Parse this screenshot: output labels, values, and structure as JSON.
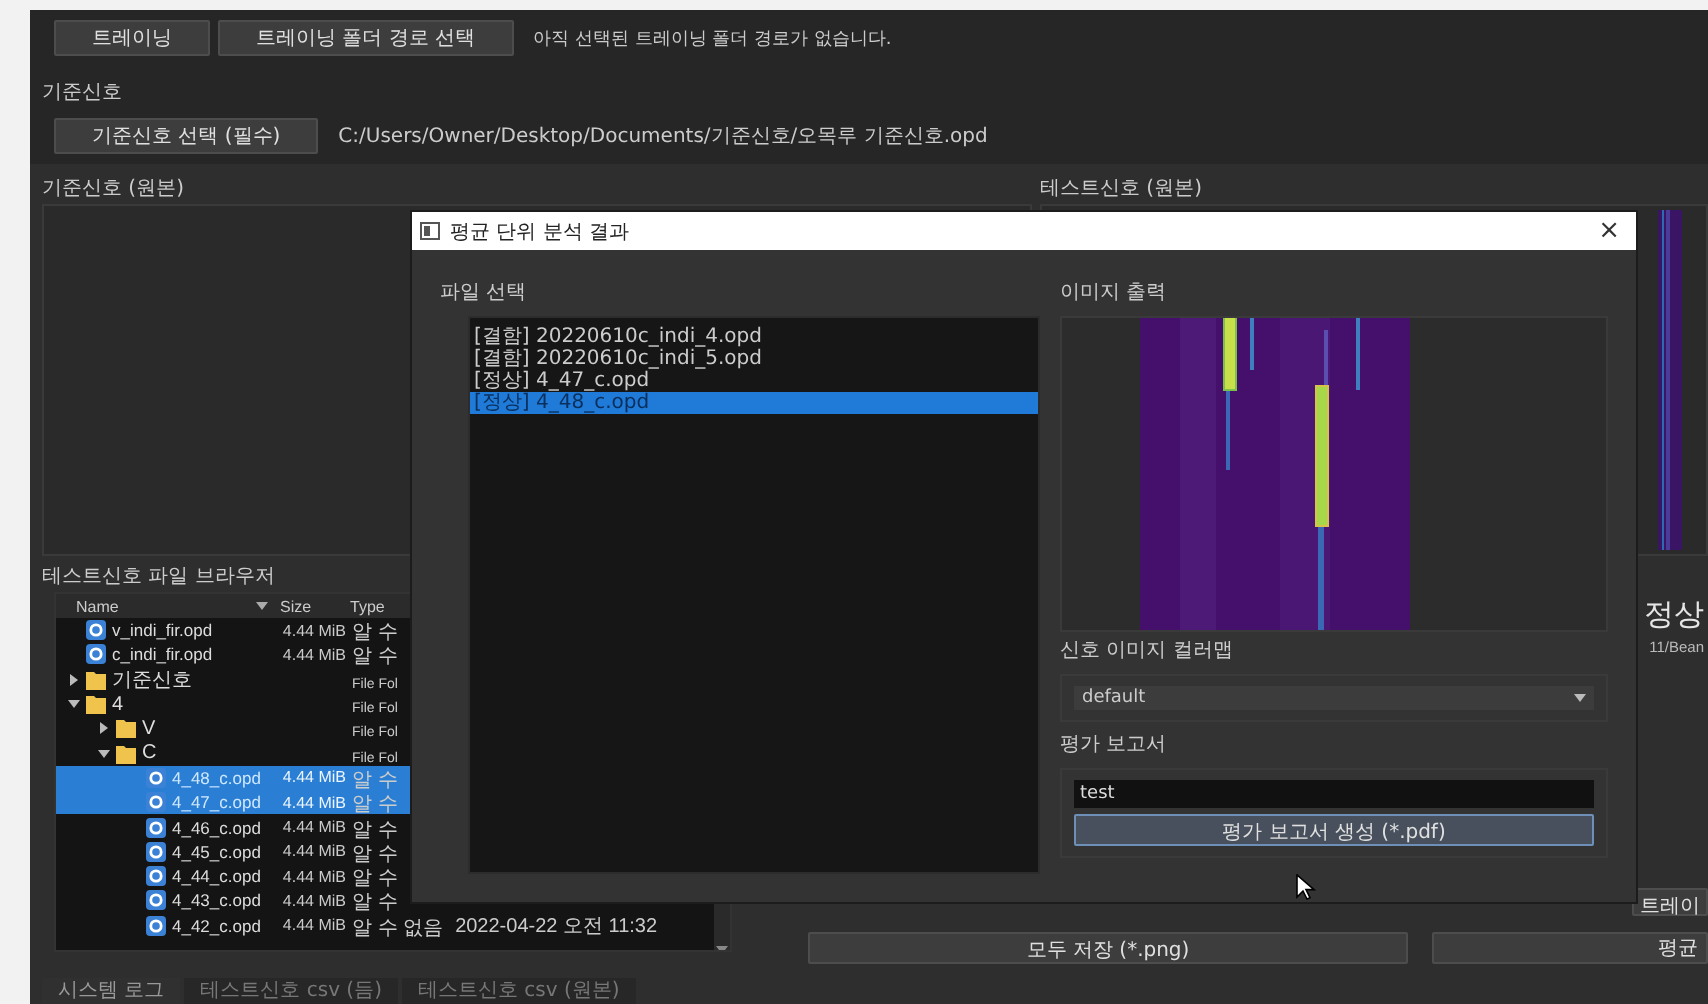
{
  "toolbar": {
    "buttons": [
      "트레이닝",
      "트레이닝 폴더 경로 선택"
    ],
    "status": "아직 선택된 트레이닝 폴더 경로가 없습니다."
  },
  "reference": {
    "section": "기준신호",
    "button": "기준신호 선택 (필수)",
    "path": "C:/Users/Owner/Desktop/Documents/기준신호/오목루 기준신호.opd"
  },
  "panels": [
    {
      "title": "기준신호 (원본)"
    },
    {
      "title": "테스트신호 (원본)"
    }
  ],
  "browser": {
    "title": "테스트신호 파일 브라우저",
    "columns": [
      "Name",
      "Size",
      "Type"
    ],
    "rows": [
      {
        "kind": "file",
        "name": "v_indi_fir.opd",
        "size": "4.44 MiB",
        "type": "알 수",
        "selected": false
      },
      {
        "kind": "file",
        "name": "c_indi_fir.opd",
        "size": "4.44 MiB",
        "type": "알 수",
        "selected": false
      },
      {
        "kind": "folder",
        "name": "기준신호",
        "type": "File Fol",
        "expanded": false,
        "selected": false
      },
      {
        "kind": "folder",
        "name": "4",
        "type": "File Fol",
        "expanded": true,
        "selected": false,
        "children": [
          {
            "kind": "folder",
            "name": "V",
            "type": "File Fol",
            "expanded": false,
            "selected": false
          },
          {
            "kind": "folder",
            "name": "C",
            "type": "File Fol",
            "expanded": true,
            "selected": false,
            "children": [
              {
                "kind": "file",
                "name": "4_48_c.opd",
                "size": "4.44 MiB",
                "type": "알 수",
                "selected": true
              },
              {
                "kind": "file",
                "name": "4_47_c.opd",
                "size": "4.44 MiB",
                "type": "알 수",
                "selected": true
              },
              {
                "kind": "file",
                "name": "4_46_c.opd",
                "size": "4.44 MiB",
                "type": "알 수",
                "selected": false
              },
              {
                "kind": "file",
                "name": "4_45_c.opd",
                "size": "4.44 MiB",
                "type": "알 수",
                "selected": false
              },
              {
                "kind": "file",
                "name": "4_44_c.opd",
                "size": "4.44 MiB",
                "type": "알 수",
                "selected": false
              },
              {
                "kind": "file",
                "name": "4_43_c.opd",
                "size": "4.44 MiB",
                "type": "알 수",
                "selected": false
              },
              {
                "kind": "file",
                "name": "4_42_c.opd",
                "size": "4.44 MiB",
                "type": "알 수 없음",
                "date": "2022-04-22 오전 11:32",
                "selected": false
              }
            ]
          }
        ]
      }
    ]
  },
  "result": {
    "status": "정상",
    "path": "11/Bean",
    "button": "트레이"
  },
  "actions": [
    "모두 저장 (*.png)",
    "평균"
  ],
  "bottom_tabs": [
    {
      "label": "시스템 로그",
      "selected": true
    },
    {
      "label": "테스트신호 csv (듬)",
      "selected": false
    },
    {
      "label": "테스트신호 csv (원본)",
      "selected": false
    }
  ],
  "dialog": {
    "title": "평균 단위 분석 결과",
    "close": "×",
    "file_group": "파일 선택",
    "files": [
      {
        "label": "[결함] 20220610c_indi_4.opd",
        "selected": false
      },
      {
        "label": "[결함] 20220610c_indi_5.opd",
        "selected": false
      },
      {
        "label": "[정상] 4_47_c.opd",
        "selected": false
      },
      {
        "label": "[정상] 4_48_c.opd",
        "selected": true
      }
    ],
    "image_group": "이미지 출력",
    "colormap_label": "신호 이미지 컬러맵",
    "colormap": "default",
    "report_label": "평가 보고서",
    "report_name": "test",
    "report_button": "평가 보고서 생성 (*.pdf)"
  }
}
